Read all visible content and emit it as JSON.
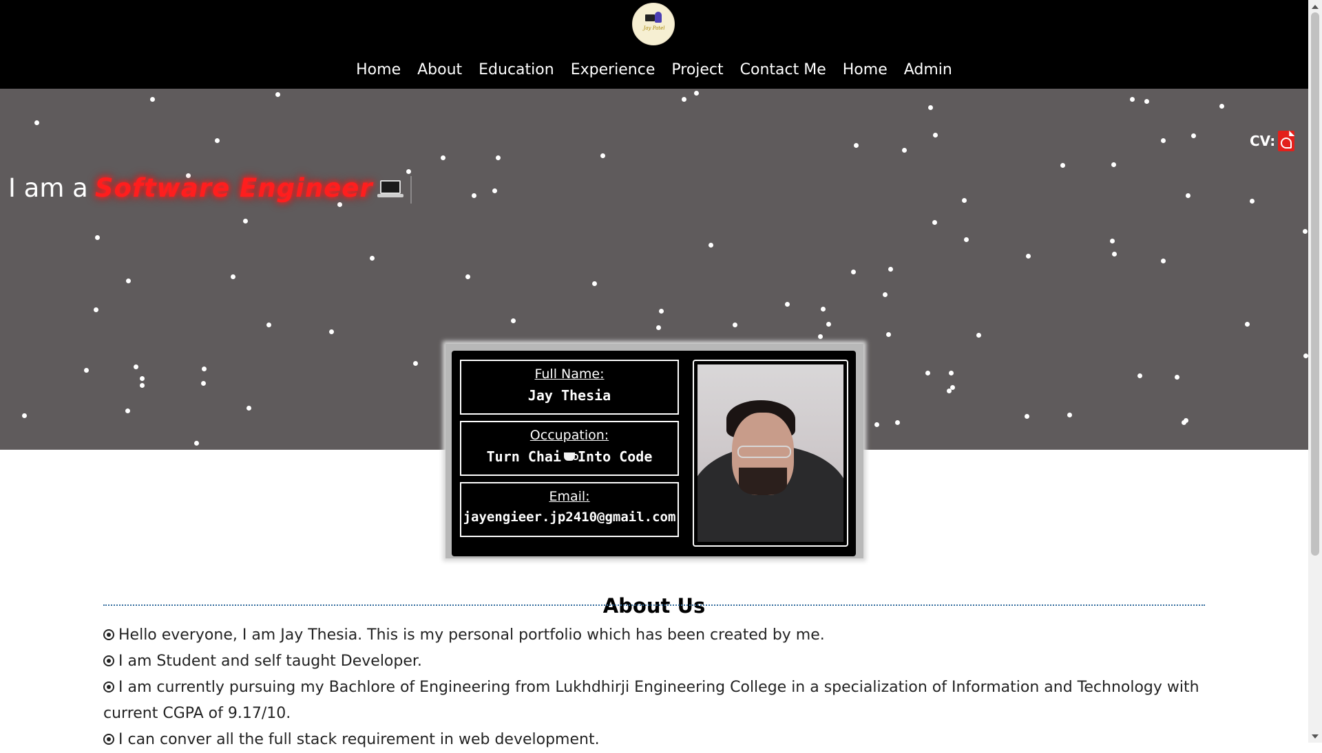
{
  "header": {
    "logo_icon": "avatar-logo-icon",
    "logo_signature": "Jay Patel",
    "nav": [
      {
        "label": "Home"
      },
      {
        "label": "About"
      },
      {
        "label": "Education"
      },
      {
        "label": "Experience"
      },
      {
        "label": "Project"
      },
      {
        "label": "Contact Me"
      },
      {
        "label": "Home"
      },
      {
        "label": "Admin"
      }
    ]
  },
  "hero": {
    "prefix": "I am a",
    "role": "Software Engineer",
    "role_icon": "laptop-icon",
    "cv_label": "CV:",
    "cv_icon": "pdf-icon",
    "background_color": "#5f5b5c",
    "accent_color": "#ff1e1e"
  },
  "profile": {
    "full_name_label": "Full Name:",
    "full_name": "Jay Thesia",
    "occupation_label": "Occupation:",
    "occupation_pre": "Turn Chai",
    "occupation_icon": "tea-cup-icon",
    "occupation_post": "Into Code",
    "email_label": "Email:",
    "email": "jayengieer.jp2410@gmail.com"
  },
  "about": {
    "title": "About Us",
    "items": [
      {
        "text": "Hello everyone, I am Jay Thesia. This is my personal portfolio which has been created by me."
      },
      {
        "text": "I am Student and self taught Developer."
      },
      {
        "text": "I am currently pursuing my Bachlore of Engineering from Lukhdhirji Engineering College in a specialization of Information and Technology with current CGPA of 9.17/10."
      },
      {
        "text": "I can conver all the full stack requirement in web development."
      }
    ]
  }
}
